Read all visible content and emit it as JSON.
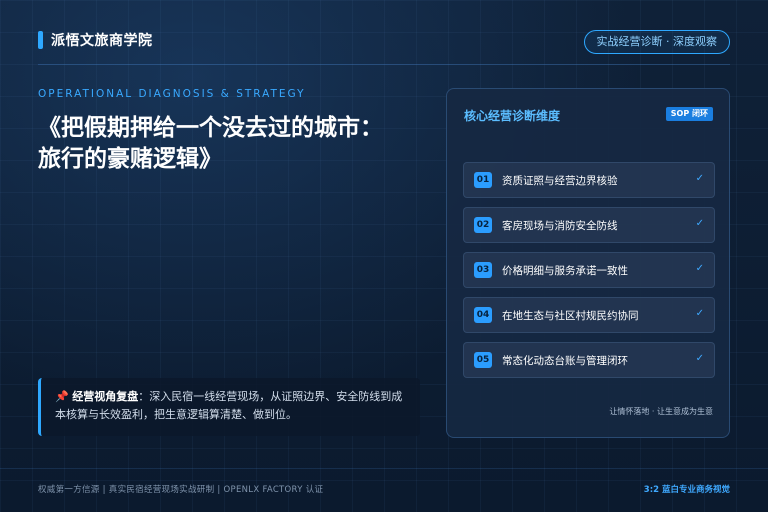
{
  "brand": {
    "name": "派悟文旅商学院"
  },
  "header_badge": "实战经营诊断 · 深度观察",
  "hero": {
    "subtitle_en": "OPERATIONAL DIAGNOSIS & STRATEGY",
    "title": "《把假期押给一个没去过的城市：旅行的豪赌逻辑》"
  },
  "note": {
    "icon": "pushpin-icon",
    "label": "经营视角复盘",
    "text": "：深入民宿一线经营现场，从证照边界、安全防线到成本核算与长效盈利，把生意逻辑算清楚、做到位。"
  },
  "panel": {
    "title": "核心经营诊断维度",
    "chip": "SOP 闭环",
    "items": [
      {
        "num": "01",
        "label": "资质证照与经营边界核验",
        "check": "✓"
      },
      {
        "num": "02",
        "label": "客房现场与消防安全防线",
        "check": "✓"
      },
      {
        "num": "03",
        "label": "价格明细与服务承诺一致性",
        "check": "✓"
      },
      {
        "num": "04",
        "label": "在地生态与社区村规民约协同",
        "check": "✓"
      },
      {
        "num": "05",
        "label": "常态化动态台账与管理闭环",
        "check": "✓"
      }
    ],
    "footer": "让情怀落地 · 让生意成为生意"
  },
  "footer": {
    "left": "权威第一方信源 | 真实民宿经营现场实战研制 | OPENLX FACTORY 认证",
    "right": "3:2 蓝白专业商务视觉"
  }
}
